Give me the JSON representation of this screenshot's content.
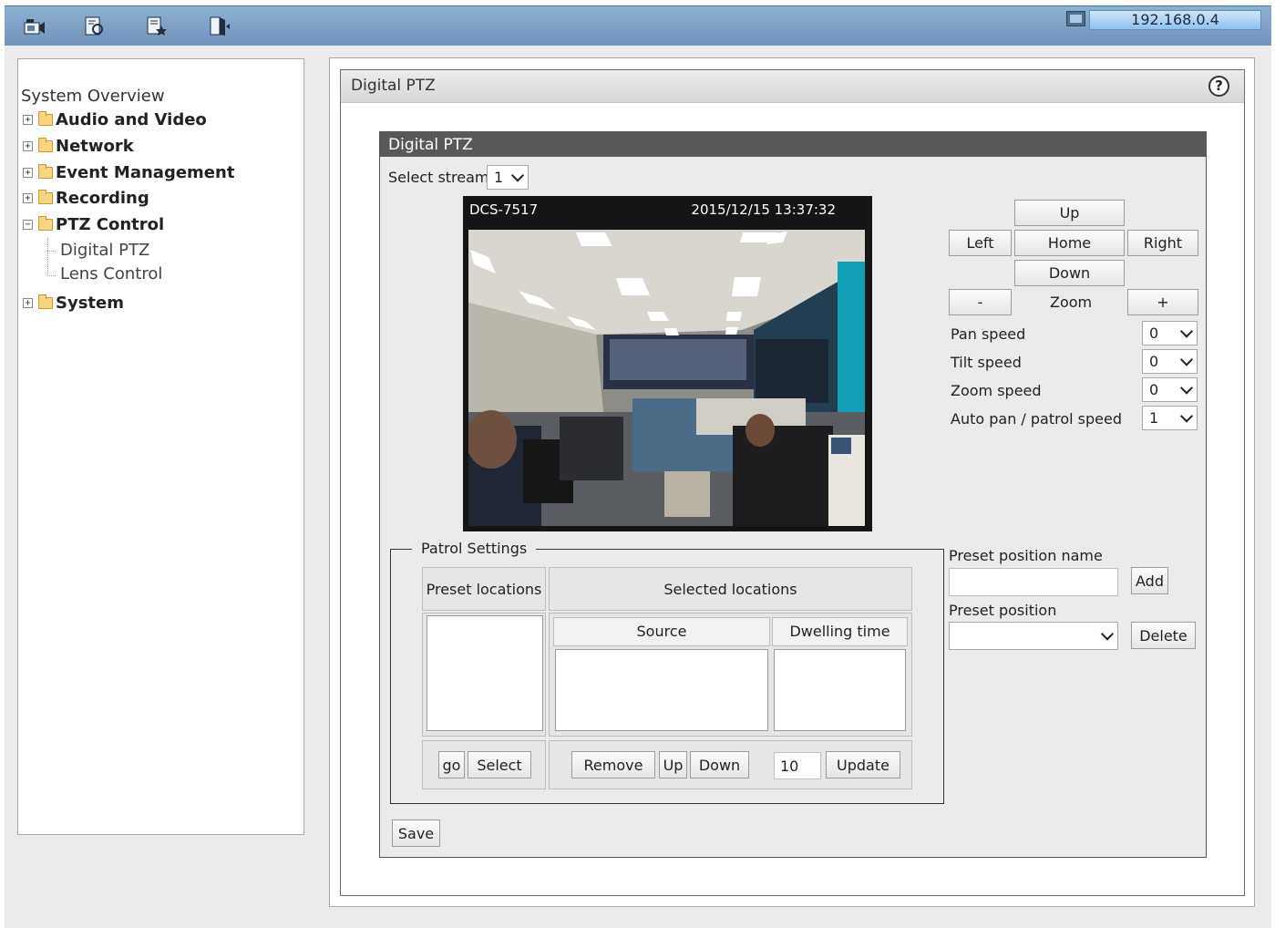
{
  "topbar": {
    "icons": [
      "live-video-icon",
      "setup-icon",
      "maintenance-icon",
      "logout-icon"
    ],
    "ip_address": "192.168.0.4"
  },
  "sidebar": {
    "overview": "System Overview",
    "items": [
      {
        "label": "Audio and Video",
        "expander": "+"
      },
      {
        "label": "Network",
        "expander": "+"
      },
      {
        "label": "Event Management",
        "expander": "+"
      },
      {
        "label": "Recording",
        "expander": "+"
      },
      {
        "label": "PTZ Control",
        "expander": "−"
      },
      {
        "label": "System",
        "expander": "+"
      }
    ],
    "sub_items": [
      "Digital PTZ",
      "Lens Control"
    ]
  },
  "page": {
    "title": "Digital PTZ",
    "section_title": "Digital PTZ"
  },
  "stream": {
    "label": "Select stream",
    "value": "1"
  },
  "video": {
    "camera_name": "DCS-7517",
    "timestamp": "2015/12/15 13:37:32"
  },
  "ptz": {
    "up": "Up",
    "left": "Left",
    "home": "Home",
    "right": "Right",
    "down": "Down",
    "zoom_out": "-",
    "zoom_label": "Zoom",
    "zoom_in": "+"
  },
  "speeds": [
    {
      "label": "Pan speed",
      "value": "0"
    },
    {
      "label": "Tilt speed",
      "value": "0"
    },
    {
      "label": "Zoom speed",
      "value": "0"
    },
    {
      "label": "Auto pan / patrol speed",
      "value": "1"
    }
  ],
  "patrol": {
    "legend": "Patrol Settings",
    "preset_locations": "Preset locations",
    "selected_locations": "Selected locations",
    "source": "Source",
    "dwelling_time": "Dwelling time",
    "go": "go",
    "select": "Select",
    "remove": "Remove",
    "up": "Up",
    "down": "Down",
    "dwell_value": "10",
    "update": "Update"
  },
  "preset": {
    "name_label": "Preset position name",
    "name_value": "",
    "add": "Add",
    "position_label": "Preset position",
    "position_value": "",
    "delete": "Delete"
  },
  "save": "Save"
}
